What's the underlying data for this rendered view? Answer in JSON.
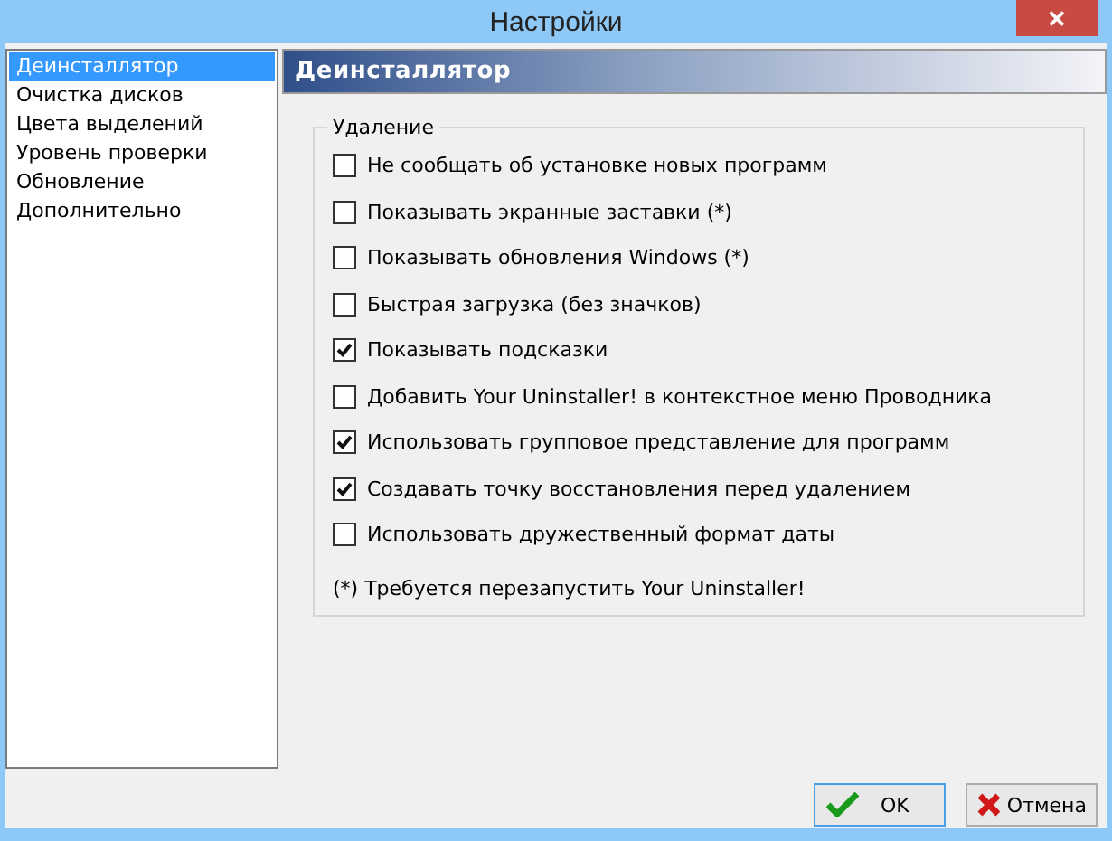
{
  "window": {
    "title": "Настройки",
    "close": "✕"
  },
  "sidebar": {
    "items": [
      {
        "label": "Деинсталлятор",
        "selected": true
      },
      {
        "label": "Очистка дисков",
        "selected": false
      },
      {
        "label": "Цвета выделений",
        "selected": false
      },
      {
        "label": "Уровень проверки",
        "selected": false
      },
      {
        "label": "Обновление",
        "selected": false
      },
      {
        "label": "Дополнительно",
        "selected": false
      }
    ]
  },
  "panel": {
    "heading": "Деинсталлятор",
    "group": {
      "title": "Удаление",
      "options": [
        {
          "label": "Не сообщать об установке новых программ",
          "checked": false
        },
        {
          "label": "Показывать экранные заставки (*)",
          "checked": false
        },
        {
          "label": "Показывать обновления Windows (*)",
          "checked": false
        },
        {
          "label": "Быстрая загрузка (без значков)",
          "checked": false
        },
        {
          "label": "Показывать подсказки",
          "checked": true
        },
        {
          "label": "Добавить Your Uninstaller! в контекстное меню Проводника",
          "checked": false
        },
        {
          "label": "Использовать групповое представление для программ",
          "checked": true
        },
        {
          "label": "Создавать точку восстановления перед удалением",
          "checked": true
        },
        {
          "label": "Использовать дружественный формат даты",
          "checked": false
        }
      ],
      "note": "(*) Требуется перезапустить Your Uninstaller!"
    }
  },
  "buttons": [
    {
      "kind": "ok",
      "label": "OK"
    },
    {
      "kind": "cancel",
      "label": "Отмена"
    }
  ]
}
